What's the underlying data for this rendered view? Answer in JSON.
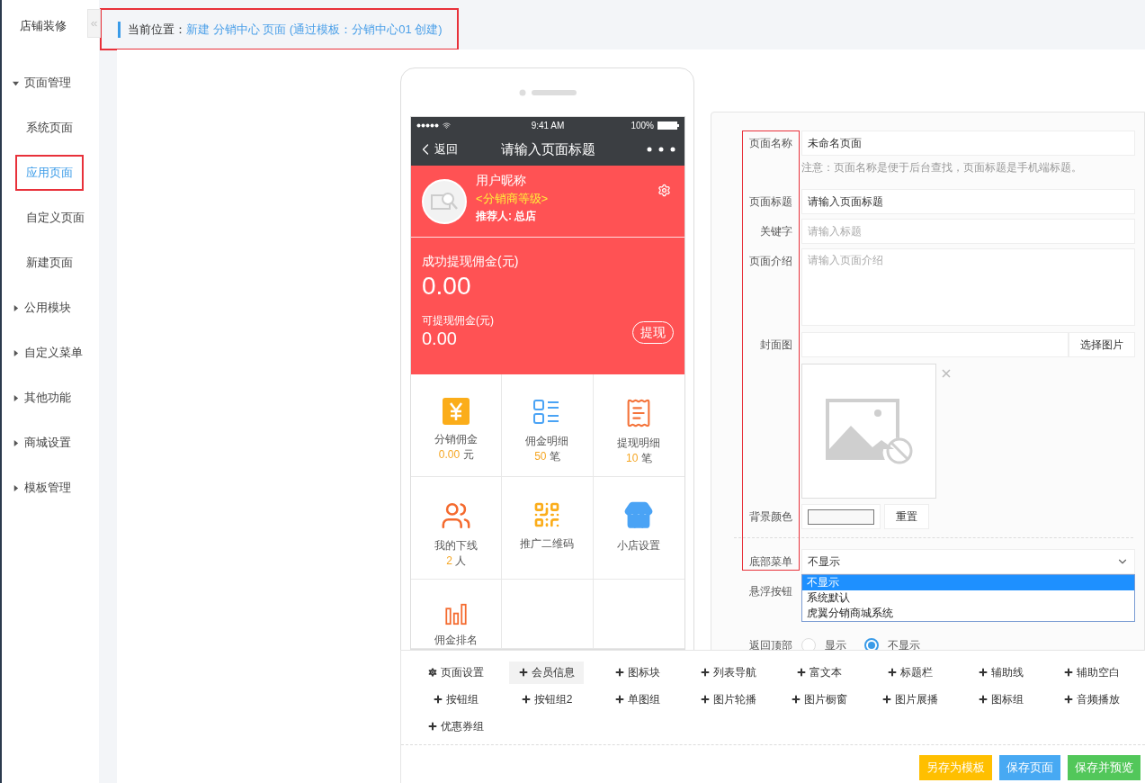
{
  "sidebar": {
    "title": "店铺装修",
    "items": [
      {
        "label": "页面管理",
        "expanded": true,
        "children": [
          {
            "label": "系统页面",
            "selected": false
          },
          {
            "label": "应用页面",
            "selected": true
          },
          {
            "label": "自定义页面",
            "selected": false
          },
          {
            "label": "新建页面",
            "selected": false
          }
        ]
      },
      {
        "label": "公用模块",
        "expanded": false
      },
      {
        "label": "自定义菜单",
        "expanded": false
      },
      {
        "label": "其他功能",
        "expanded": false
      },
      {
        "label": "商城设置",
        "expanded": false
      },
      {
        "label": "模板管理",
        "expanded": false
      }
    ]
  },
  "breadcrumb": {
    "label": "当前位置：",
    "path": "新建 分销中心 页面 (通过模板：分销中心01 创建)"
  },
  "phone": {
    "status_bar": {
      "time": "9:41 AM",
      "battery": "100%"
    },
    "nav": {
      "back": "返回",
      "title": "请输入页面标题"
    },
    "member": {
      "nickname": "用户昵称",
      "level": "<分销商等级>",
      "referrer": "推荐人: 总店"
    },
    "commission": {
      "label": "成功提现佣金(元)",
      "amount": "0.00",
      "available_label": "可提现佣金(元)",
      "available_amount": "0.00",
      "withdraw": "提现"
    },
    "tiles": [
      {
        "kind": "yen",
        "title": "分销佣金",
        "count": "0.00",
        "unit": "元"
      },
      {
        "kind": "list",
        "title": "佣金明细",
        "count": "50",
        "unit": "笔"
      },
      {
        "kind": "receipt",
        "title": "提现明细",
        "count": "10",
        "unit": "笔"
      },
      {
        "kind": "users",
        "title": "我的下线",
        "count": "2",
        "unit": "人"
      },
      {
        "kind": "qrcode",
        "title": "推广二维码"
      },
      {
        "kind": "store",
        "title": "小店设置"
      },
      {
        "kind": "ranking",
        "title": "佣金排名"
      }
    ]
  },
  "form": {
    "fields": [
      {
        "kind": "text",
        "label": "页面名称",
        "value": "未命名页面",
        "note": "注意：页面名称是便于后台查找，页面标题是手机端标题。"
      },
      {
        "kind": "text",
        "label": "页面标题",
        "value": "请输入页面标题"
      },
      {
        "kind": "text",
        "label": "关键字",
        "placeholder": "请输入标题"
      },
      {
        "kind": "textarea",
        "label": "页面介绍",
        "placeholder": "请输入页面介绍"
      },
      {
        "kind": "image",
        "label": "封面图",
        "button": "选择图片"
      },
      {
        "kind": "color",
        "label": "背景颜色",
        "button": "重置"
      },
      {
        "kind": "select",
        "label": "底部菜单",
        "value": "不显示",
        "options": [
          {
            "label": "不显示",
            "selected": true
          },
          {
            "label": "系统默认",
            "selected": false
          },
          {
            "label": "虎翼分销商城系统",
            "selected": false
          }
        ]
      },
      {
        "kind": "empty",
        "label": "悬浮按钮"
      },
      {
        "kind": "radio",
        "label": "返回顶部",
        "options": [
          {
            "label": "显示",
            "selected": false
          },
          {
            "label": "不显示",
            "selected": true
          }
        ]
      }
    ]
  },
  "toolbar": {
    "modules": [
      {
        "kind": "settings",
        "label": "页面设置",
        "selected": false
      },
      {
        "kind": "add",
        "label": "会员信息",
        "selected": true
      },
      {
        "kind": "add",
        "label": "图标块",
        "selected": false
      },
      {
        "kind": "add",
        "label": "列表导航",
        "selected": false
      },
      {
        "kind": "add",
        "label": "富文本",
        "selected": false
      },
      {
        "kind": "add",
        "label": "标题栏",
        "selected": false
      },
      {
        "kind": "add",
        "label": "辅助线",
        "selected": false
      },
      {
        "kind": "add",
        "label": "辅助空白",
        "selected": false
      },
      {
        "kind": "add",
        "label": "按钮组",
        "selected": false
      },
      {
        "kind": "add",
        "label": "按钮组2",
        "selected": false
      },
      {
        "kind": "add",
        "label": "单图组",
        "selected": false
      },
      {
        "kind": "add",
        "label": "图片轮播",
        "selected": false
      },
      {
        "kind": "add",
        "label": "图片橱窗",
        "selected": false
      },
      {
        "kind": "add",
        "label": "图片展播",
        "selected": false
      },
      {
        "kind": "add",
        "label": "图标组",
        "selected": false
      },
      {
        "kind": "add",
        "label": "音频播放",
        "selected": false
      },
      {
        "kind": "add",
        "label": "优惠券组",
        "selected": false
      }
    ],
    "actions": [
      {
        "label": "另存为模板",
        "color": "#ffbf00"
      },
      {
        "label": "保存页面",
        "color": "#47a9f3"
      },
      {
        "label": "保存并预览",
        "color": "#52c75a"
      }
    ]
  }
}
